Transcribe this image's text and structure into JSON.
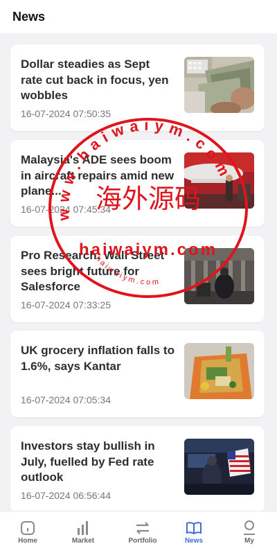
{
  "header": {
    "title": "News"
  },
  "articles": [
    {
      "headline": "Dollar steadies as Sept rate cut back in focus, yen wobbles",
      "time": "16-07-2024 07:50:35",
      "image": "money-photo"
    },
    {
      "headline": "Malaysia's ADE sees boom in aircraft repairs amid new plane...",
      "time": "16-07-2024 07:45:34",
      "image": "aircraft-hangar-photo"
    },
    {
      "headline": "Pro Research: Wall Street sees bright future for Salesforce",
      "time": "16-07-2024 07:33:25",
      "image": "stock-exchange-photo"
    },
    {
      "headline": "UK grocery inflation falls to 1.6%, says Kantar",
      "time": "16-07-2024 07:05:34",
      "image": "grocery-bag-photo"
    },
    {
      "headline": "Investors stay bullish in July, fuelled by Fed rate outlook",
      "time": "16-07-2024 06:56:44",
      "image": "trading-floor-photo"
    }
  ],
  "tabbar": {
    "items": [
      {
        "label": "Home",
        "icon": "home-icon"
      },
      {
        "label": "Market",
        "icon": "bar-chart-icon"
      },
      {
        "label": "Portfolio",
        "icon": "swap-arrows-icon"
      },
      {
        "label": "News",
        "icon": "book-icon"
      },
      {
        "label": "My",
        "icon": "user-icon"
      }
    ],
    "active": "News",
    "active_color": "#3b6fd4"
  },
  "watermark": {
    "url_text": "www.haiwaiym.com",
    "cn_text": "海外源码",
    "domain_text": "haiwaiym.com",
    "small_text": "haiwaiym.com",
    "color": "#e0141c"
  }
}
